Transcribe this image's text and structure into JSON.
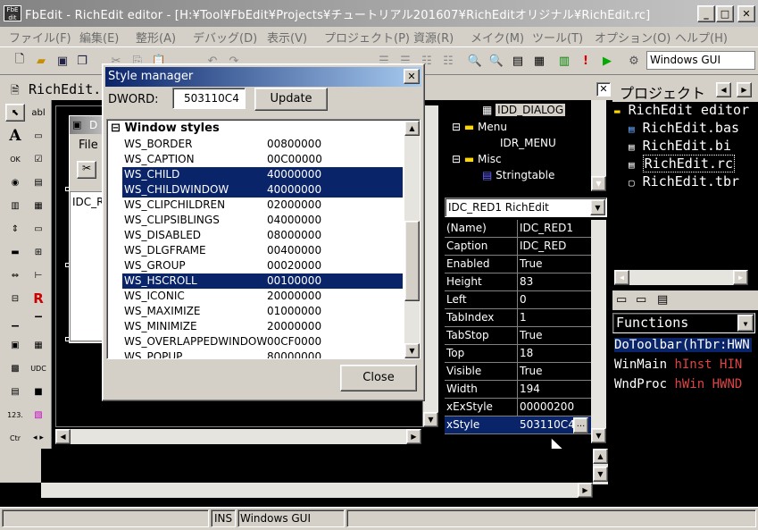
{
  "window": {
    "title": "FbEdit - RichEdit editor - [H:¥Tool¥FbEdit¥Projects¥チュートリアル201607¥RichEditオリジナル¥RichEdit.rc]",
    "app_icon": "fbedit-icon"
  },
  "menu": [
    "ファイル(F)",
    "編集(E)",
    "整形(A)",
    "デバッグ(D)",
    "表示(V)",
    "プロジェクト(P)",
    "資源(R)",
    "メイク(M)",
    "ツール(T)",
    "オプション(O)",
    "ヘルプ(H)"
  ],
  "toolbar": {
    "build_target": "Windows GUI"
  },
  "editor_tab": {
    "label": "RichEdit."
  },
  "design": {
    "dialog_title": "D",
    "menu_file": "File",
    "control_label": "IDC_R"
  },
  "style_manager": {
    "title": "Style manager",
    "dword_label": "DWORD:",
    "dword_value": "503110C4",
    "update_label": "Update",
    "group_label": "Window styles",
    "group_toggle": "⊟",
    "close_label": "Close",
    "rows": [
      {
        "name": "WS_BORDER",
        "value": "00800000",
        "selected": false
      },
      {
        "name": "WS_CAPTION",
        "value": "00C00000",
        "selected": false
      },
      {
        "name": "WS_CHILD",
        "value": "40000000",
        "selected": true
      },
      {
        "name": "WS_CHILDWINDOW",
        "value": "40000000",
        "selected": true
      },
      {
        "name": "WS_CLIPCHILDREN",
        "value": "02000000",
        "selected": false
      },
      {
        "name": "WS_CLIPSIBLINGS",
        "value": "04000000",
        "selected": false
      },
      {
        "name": "WS_DISABLED",
        "value": "08000000",
        "selected": false
      },
      {
        "name": "WS_DLGFRAME",
        "value": "00400000",
        "selected": false
      },
      {
        "name": "WS_GROUP",
        "value": "00020000",
        "selected": false
      },
      {
        "name": "WS_HSCROLL",
        "value": "00100000",
        "selected": true
      },
      {
        "name": "WS_ICONIC",
        "value": "20000000",
        "selected": false
      },
      {
        "name": "WS_MAXIMIZE",
        "value": "01000000",
        "selected": false
      },
      {
        "name": "WS_MINIMIZE",
        "value": "20000000",
        "selected": false
      },
      {
        "name": "WS_OVERLAPPEDWINDOW",
        "value": "00CF0000",
        "selected": false
      },
      {
        "name": "WS_POPUP",
        "value": "80000000",
        "selected": false
      }
    ]
  },
  "resource_tree": {
    "items": [
      {
        "label": "IDD_DIALOG",
        "level": 2
      },
      {
        "label": "Menu",
        "level": 1
      },
      {
        "label": "IDR_MENU",
        "level": 2
      },
      {
        "label": "Misc",
        "level": 1
      },
      {
        "label": "Stringtable",
        "level": 2
      }
    ]
  },
  "properties": {
    "selector": "IDC_RED1 RichEdit",
    "rows": [
      {
        "name": "(Name)",
        "value": "IDC_RED1"
      },
      {
        "name": "Caption",
        "value": "IDC_RED"
      },
      {
        "name": "Enabled",
        "value": "True"
      },
      {
        "name": "Height",
        "value": "83"
      },
      {
        "name": "Left",
        "value": "0"
      },
      {
        "name": "TabIndex",
        "value": "1"
      },
      {
        "name": "TabStop",
        "value": "True"
      },
      {
        "name": "Top",
        "value": "18"
      },
      {
        "name": "Visible",
        "value": "True"
      },
      {
        "name": "Width",
        "value": "194"
      },
      {
        "name": "xExStyle",
        "value": "00000200"
      },
      {
        "name": "xStyle",
        "value": "503110C4"
      }
    ],
    "ellipsis": "..."
  },
  "project": {
    "title": "プロジェクト",
    "files": [
      "RichEdit editor",
      "RichEdit.bas",
      "RichEdit.bi",
      "RichEdit.rc",
      "RichEdit.tbr"
    ]
  },
  "functions": {
    "selector": "Functions",
    "items": [
      {
        "name": "DoToolbar",
        "args": "(hTbr:HWN"
      },
      {
        "name": "WinMain",
        "args": " hInst HIN"
      },
      {
        "name": "WndProc",
        "args": " hWin HWND"
      }
    ]
  },
  "status": {
    "mode": "INS",
    "target": "Windows GUI"
  }
}
